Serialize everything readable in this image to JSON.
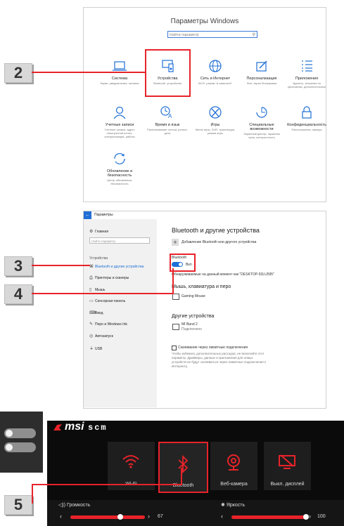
{
  "steps": {
    "s2": "2",
    "s3": "3",
    "s4": "4",
    "s5": "5"
  },
  "settings_home": {
    "title": "Параметры Windows",
    "search_placeholder": "Найти параметр",
    "tiles": [
      {
        "name": "Система",
        "desc": "Экран, уведомления, питание",
        "icon": "laptop-icon"
      },
      {
        "name": "Устройства",
        "desc": "Bluetooth, устройства",
        "icon": "devices-icon"
      },
      {
        "name": "Сеть и Интернет",
        "desc": "Wi-Fi, режим \"в самолете\"",
        "icon": "globe-icon"
      },
      {
        "name": "Персонализация",
        "desc": "Фон, экран блокировки",
        "icon": "pen-icon"
      },
      {
        "name": "Приложения",
        "desc": "Удалить, значения по умолчанию, дополнительные",
        "icon": "apps-icon"
      },
      {
        "name": "Учетные записи",
        "desc": "Учетные записи, адрес электронной почты, синхронизация, работа",
        "icon": "person-icon"
      },
      {
        "name": "Время и язык",
        "desc": "Распознавание голоса, регион, дата",
        "icon": "time-language-icon"
      },
      {
        "name": "Игры",
        "desc": "Меню игры, DVR, трансляция, режим игры",
        "icon": "xbox-icon"
      },
      {
        "name": "Специальные возможности",
        "desc": "Экранный диктор, экранная лупа, контрастность",
        "icon": "accessibility-icon"
      },
      {
        "name": "Конфиденциальность",
        "desc": "Расположение, камера",
        "icon": "lock-icon"
      },
      {
        "name": "Обновление и безопасность",
        "desc": "Центр обновления, безопасность",
        "icon": "update-icon"
      }
    ]
  },
  "devices": {
    "window_title": "Параметры",
    "home": "Главная",
    "search_placeholder": "Найти параметр",
    "section": "Устройства",
    "sidebar": [
      {
        "label": "Bluetooth и другие устройства",
        "icon": "bluetooth-icon"
      },
      {
        "label": "Принтеры и сканеры",
        "icon": "printer-icon"
      },
      {
        "label": "Мышь",
        "icon": "mouse-icon"
      },
      {
        "label": "Сенсорная панель",
        "icon": "touchpad-icon"
      },
      {
        "label": "Ввод",
        "icon": "keyboard-icon"
      },
      {
        "label": "Перо и Windows Ink",
        "icon": "pen-icon"
      },
      {
        "label": "Автозапуск",
        "icon": "autoplay-icon"
      },
      {
        "label": "USB",
        "icon": "usb-icon"
      }
    ],
    "heading": "Bluetooth и другие устройства",
    "add_device": "Добавление Bluetooth или другого устройства",
    "bt_label": "Bluetooth",
    "bt_state": "Вкл",
    "discoverable": "Обнаруживаемые на данный момент как \"DESKTOP-93LU595\"",
    "mouse_section": "Мышь, клавиатура и перо",
    "mouse_device": "Gaming Mouse",
    "other_section": "Другие устройства",
    "other_device": "MI Band 2",
    "other_status": "Подключено",
    "metered_label": "Скачивание через лимитные подключения",
    "metered_desc": "Чтобы избежать дополнительных расходов, не включайте этот параметр. Драйверы, данные и приложения для новых устройств не будут скачиваться через лимитные подключения к Интернету."
  },
  "scm": {
    "brand": "msi",
    "product": "SCM",
    "tiles": [
      {
        "label": "Wi-Fi",
        "icon": "wifi-icon"
      },
      {
        "label": "Bluetooth",
        "icon": "bluetooth-icon"
      },
      {
        "label": "Веб-камера",
        "icon": "webcam-icon"
      },
      {
        "label": "Выкл. дисплей",
        "icon": "display-off-icon"
      }
    ],
    "volume_label": "Громкость",
    "volume_value": "67",
    "volume_level": 67,
    "brightness_label": "Яркость",
    "brightness_value": "100",
    "brightness_level": 100,
    "accent": "#e8232a"
  }
}
